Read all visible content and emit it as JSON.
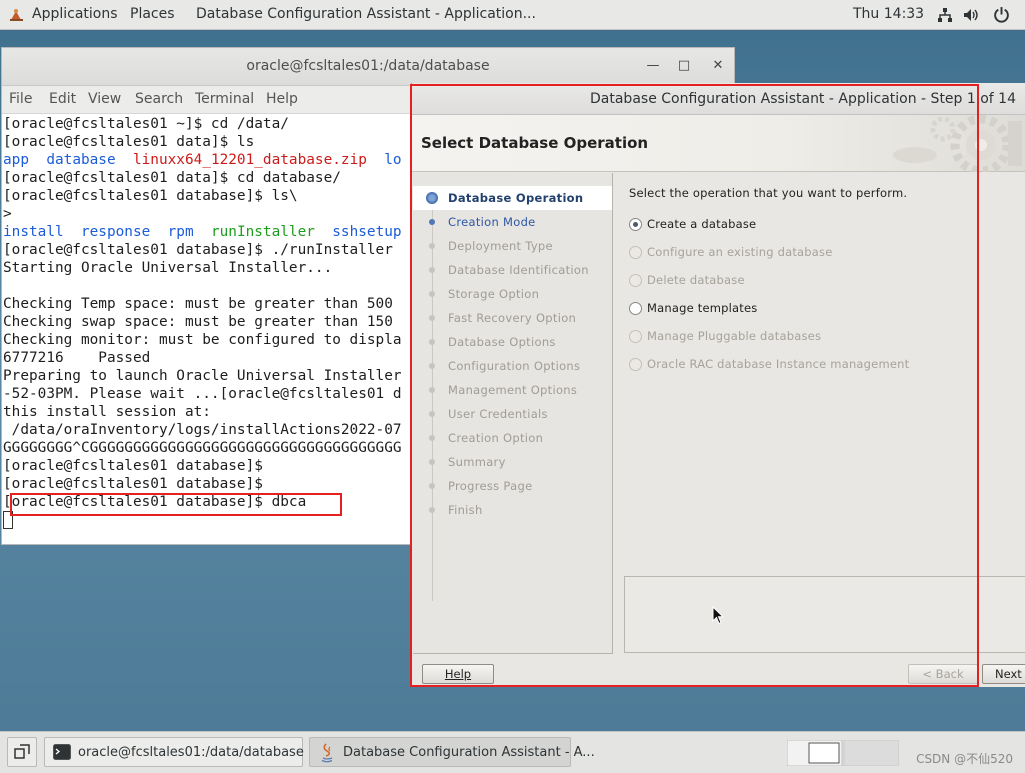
{
  "topbar": {
    "applications": "Applications",
    "places": "Places",
    "active_app": "Database Configuration Assistant - Application...",
    "clock": "Thu 14:33",
    "icons": [
      "network-icon",
      "volume-icon",
      "power-icon"
    ]
  },
  "terminal": {
    "title": "oracle@fcsltales01:/data/database",
    "menu": [
      "File",
      "Edit",
      "View",
      "Search",
      "Terminal",
      "Help"
    ],
    "lines": [
      "[oracle@fcsltales01 ~]$ cd /data/",
      "[oracle@fcsltales01 data]$ ls",
      "",
      "[oracle@fcsltales01 data]$ cd database/",
      "[oracle@fcsltales01 database]$ ls\\",
      ">",
      "",
      "[oracle@fcsltales01 database]$ ./runInstaller",
      "Starting Oracle Universal Installer...",
      "",
      "Checking Temp space: must be greater than 500",
      "Checking swap space: must be greater than 150",
      "Checking monitor: must be configured to displa",
      "6777216    Passed",
      "Preparing to launch Oracle Universal Installer",
      "-52-03PM. Please wait ...[oracle@fcsltales01 d",
      "this install session at:",
      " /data/oraInventory/logs/installActions2022-07",
      "GGGGGGGG^CGGGGGGGGGGGGGGGGGGGGGGGGGGGGGGGGGGGG",
      "[oracle@fcsltales01 database]$",
      "[oracle@fcsltales01 database]$",
      "[oracle@fcsltales01 database]$ dbca"
    ],
    "ls_data": {
      "app": "app",
      "database": "database",
      "zip": "linuxx64_12201_database.zip",
      "lo": "lo"
    },
    "ls_database": {
      "install": "install",
      "response": "response",
      "rpm": "rpm",
      "runInstaller": "runInstaller",
      "sshsetup": "sshsetup"
    }
  },
  "dbca": {
    "window_title": "Database Configuration Assistant - Application - Step 1 of 14",
    "heading": "Select Database Operation",
    "steps": [
      "Database Operation",
      "Creation Mode",
      "Deployment Type",
      "Database Identification",
      "Storage Option",
      "Fast Recovery Option",
      "Database Options",
      "Configuration Options",
      "Management Options",
      "User Credentials",
      "Creation Option",
      "Summary",
      "Progress Page",
      "Finish"
    ],
    "prompt": "Select the operation that you want to perform.",
    "options": [
      {
        "label": "Create a database",
        "checked": true,
        "enabled": true
      },
      {
        "label": "Configure an existing database",
        "checked": false,
        "enabled": false
      },
      {
        "label": "Delete database",
        "checked": false,
        "enabled": false
      },
      {
        "label": "Manage templates",
        "checked": false,
        "enabled": true
      },
      {
        "label": "Manage Pluggable databases",
        "checked": false,
        "enabled": false
      },
      {
        "label": "Oracle RAC database Instance management",
        "checked": false,
        "enabled": false
      }
    ],
    "buttons": {
      "help": "Help",
      "back": "< Back",
      "next": "Next >"
    }
  },
  "taskbar": {
    "task_terminal": "oracle@fcsltales01:/data/database",
    "task_dbca": "Database Configuration Assistant - A...",
    "watermark": "CSDN @不仙520"
  },
  "colors": {
    "highlight": "#e62020",
    "link": "#2d56a4",
    "ls_dir": "#1c5cd8",
    "ls_archive": "#cc1b1b",
    "ls_exec": "#1e9e1e"
  }
}
